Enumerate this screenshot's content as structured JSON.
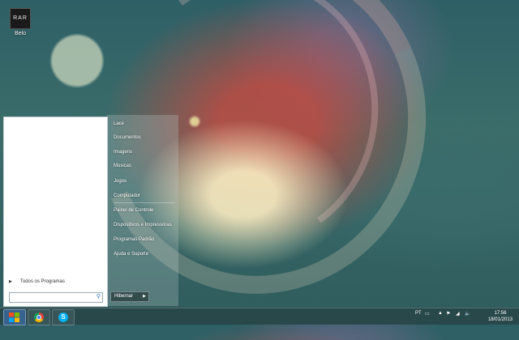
{
  "desktop": {
    "icons": [
      {
        "label": "Belo",
        "tile_text": "RAR"
      }
    ]
  },
  "start_menu": {
    "all_programs": "Todos os Programas",
    "search_placeholder": "",
    "right_items": [
      "Lace",
      "Documentos",
      "Imagens",
      "Músicas",
      "Jogos",
      "Computador",
      "Painel de Controle",
      "Dispositivos e Impressoras",
      "Programas Padrão",
      "Ajuda e Suporte"
    ],
    "shutdown_label": "Hibernar"
  },
  "taskbar": {
    "pinned": [
      "start-button",
      "chrome",
      "skype"
    ],
    "language": "PT",
    "time": "17:56",
    "date": "18/01/2013"
  },
  "colors": {
    "taskbar": "#2a4a4c",
    "menu_left": "#ffffff",
    "accent": "#2a6cb0"
  }
}
